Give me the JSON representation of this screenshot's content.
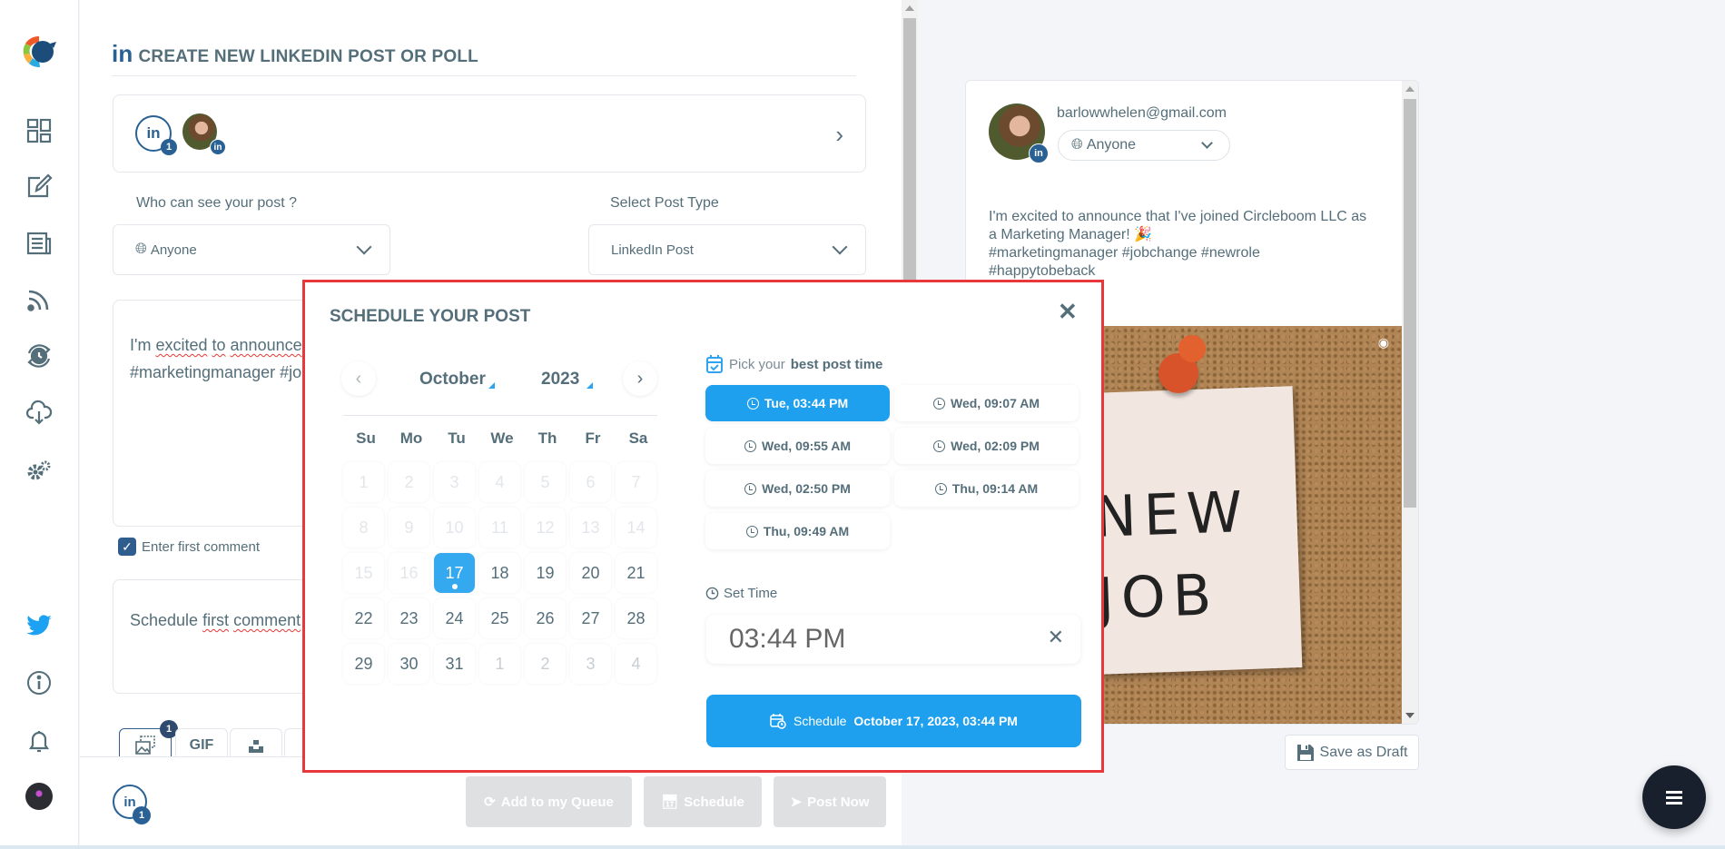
{
  "sidebar": {
    "items": [
      {
        "icon": "dashboard-icon"
      },
      {
        "icon": "edit-icon"
      },
      {
        "icon": "articles-icon"
      },
      {
        "icon": "rss-icon"
      },
      {
        "icon": "queue-schedule-icon"
      },
      {
        "icon": "cloud-download-icon"
      },
      {
        "icon": "settings-icon"
      }
    ],
    "bottom": [
      {
        "icon": "twitter-icon"
      },
      {
        "icon": "info-icon"
      },
      {
        "icon": "bell-icon"
      },
      {
        "icon": "user-avatar"
      }
    ]
  },
  "header": {
    "brand_glyph": "in",
    "title": "CREATE NEW LINKEDIN POST OR POLL"
  },
  "accounts": {
    "linkedin_glyph": "in",
    "selected_count": "1"
  },
  "visibility": {
    "label": "Who can see your post ?",
    "value": "Anyone"
  },
  "post_type": {
    "label": "Select Post Type",
    "value": "LinkedIn Post"
  },
  "composer": {
    "line1_prefix": "I'm ",
    "line1_w1": "excited",
    "line1_w2": "to",
    "line1_w3": "announce",
    "line2": "#marketingmanager #jobchange #newrole"
  },
  "first_comment": {
    "checkbox_label": "Enter first comment",
    "checked": true,
    "text_w1": "Schedule ",
    "text_w2": "first",
    "text_w3": "comment"
  },
  "media_tabs": {
    "image_badge": "1",
    "gif_label": "GIF"
  },
  "footer": {
    "account_badge": "1",
    "add_queue_label": "Add to my Queue",
    "schedule_label": "Schedule",
    "post_now_label": "Post Now"
  },
  "preview": {
    "email": "barlowwhelen@gmail.com",
    "visibility": "Anyone",
    "text_line1": "I'm excited to announce that I've joined Circleboom LLC as",
    "text_line2": "a Marketing Manager! 🎉",
    "text_line3": "#marketingmanager #jobchange #newrole",
    "text_line4": "#happytobeback",
    "image_word1": "NEW",
    "image_word2": "JOB",
    "save_draft_label": "Save as Draft"
  },
  "modal": {
    "title": "SCHEDULE YOUR POST",
    "month": "October",
    "year": "2023",
    "weekdays": [
      "Su",
      "Mo",
      "Tu",
      "We",
      "Th",
      "Fr",
      "Sa"
    ],
    "days": [
      {
        "n": "1",
        "state": "disabled"
      },
      {
        "n": "2",
        "state": "disabled"
      },
      {
        "n": "3",
        "state": "disabled"
      },
      {
        "n": "4",
        "state": "disabled"
      },
      {
        "n": "5",
        "state": "disabled"
      },
      {
        "n": "6",
        "state": "disabled"
      },
      {
        "n": "7",
        "state": "disabled"
      },
      {
        "n": "8",
        "state": "disabled"
      },
      {
        "n": "9",
        "state": "disabled"
      },
      {
        "n": "10",
        "state": "disabled"
      },
      {
        "n": "11",
        "state": "disabled"
      },
      {
        "n": "12",
        "state": "disabled"
      },
      {
        "n": "13",
        "state": "disabled"
      },
      {
        "n": "14",
        "state": "disabled"
      },
      {
        "n": "15",
        "state": "disabled"
      },
      {
        "n": "16",
        "state": "disabled"
      },
      {
        "n": "17",
        "state": "selected"
      },
      {
        "n": "18",
        "state": "enabled"
      },
      {
        "n": "19",
        "state": "enabled"
      },
      {
        "n": "20",
        "state": "enabled"
      },
      {
        "n": "21",
        "state": "enabled"
      },
      {
        "n": "22",
        "state": "enabled"
      },
      {
        "n": "23",
        "state": "enabled"
      },
      {
        "n": "24",
        "state": "enabled"
      },
      {
        "n": "25",
        "state": "enabled"
      },
      {
        "n": "26",
        "state": "enabled"
      },
      {
        "n": "27",
        "state": "enabled"
      },
      {
        "n": "28",
        "state": "enabled"
      },
      {
        "n": "29",
        "state": "enabled"
      },
      {
        "n": "30",
        "state": "enabled"
      },
      {
        "n": "31",
        "state": "enabled"
      },
      {
        "n": "1",
        "state": "other"
      },
      {
        "n": "2",
        "state": "other"
      },
      {
        "n": "3",
        "state": "other"
      },
      {
        "n": "4",
        "state": "other"
      }
    ],
    "best_time_prefix": "Pick your",
    "best_time_bold": "best post time",
    "slots": [
      {
        "label": "Tue, 03:44 PM",
        "selected": true
      },
      {
        "label": "Wed, 09:07 AM",
        "selected": false
      },
      {
        "label": "Wed, 09:55 AM",
        "selected": false
      },
      {
        "label": "Wed, 02:09 PM",
        "selected": false
      },
      {
        "label": "Wed, 02:50 PM",
        "selected": false
      },
      {
        "label": "Thu, 09:14 AM",
        "selected": false
      },
      {
        "label": "Thu, 09:49 AM",
        "selected": false
      }
    ],
    "set_time_label": "Set Time",
    "time_value": "03:44 PM",
    "schedule_prefix": "Schedule",
    "schedule_datetime": "October 17, 2023, 03:44 PM"
  },
  "colors": {
    "accent": "#1fa0ee",
    "linkedin": "#2a6194",
    "highlight_border": "#e8383b",
    "text": "#546e7a"
  }
}
